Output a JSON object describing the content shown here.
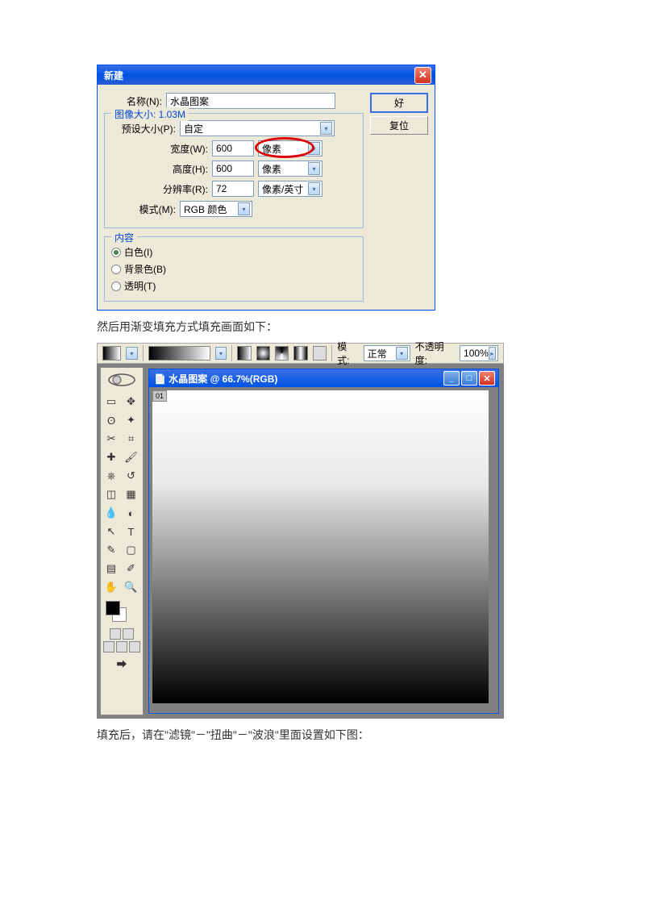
{
  "dialog": {
    "title": "新建",
    "name_label": "名称(N):",
    "name_value": "水晶图案",
    "ok_button": "好",
    "reset_button": "复位",
    "imagesize_label": "图像大小: 1.03M",
    "preset_label": "预设大小(P):",
    "preset_value": "自定",
    "width_label": "宽度(W):",
    "width_value": "600",
    "width_unit": "像素",
    "height_label": "高度(H):",
    "height_value": "600",
    "height_unit": "像素",
    "res_label": "分辨率(R):",
    "res_value": "72",
    "res_unit": "像素/英寸",
    "mode_label": "模式(M):",
    "mode_value": "RGB 颜色",
    "contents_label": "内容",
    "white": "白色(I)",
    "bgcolor": "背景色(B)",
    "transparent": "透明(T)"
  },
  "caption1": "然后用渐变填充方式填充画面如下：",
  "optbar": {
    "mode_label": "模式:",
    "mode_value": "正常",
    "opacity_label": "不透明度:",
    "opacity_value": "100%"
  },
  "doc": {
    "title": "水晶图案 @ 66.7%(RGB)",
    "tab": "01"
  },
  "caption2": "填充后，请在\"滤镜\"－\"扭曲\"－\"波浪\"里面设置如下图："
}
